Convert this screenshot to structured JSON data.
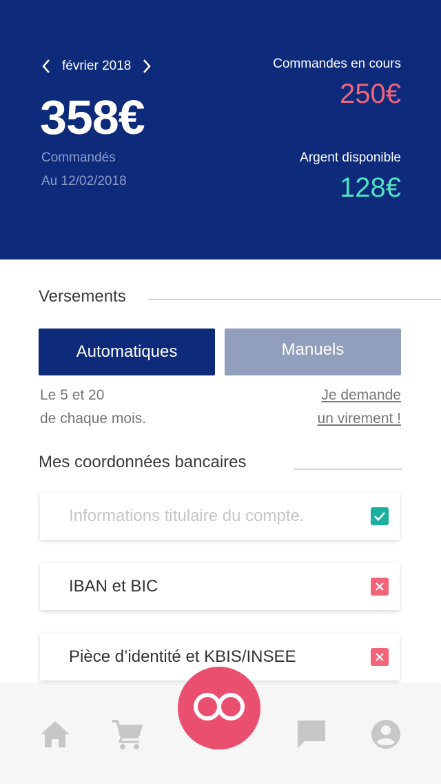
{
  "header": {
    "month": "février 2018",
    "total": "358€",
    "total_label": "Commandés",
    "date_label": "Au 12/02/2018",
    "pending_label": "Commandes en cours",
    "pending_value": "250€",
    "available_label": "Argent disponible",
    "available_value": "128€"
  },
  "payments": {
    "title": "Versements",
    "tabs": [
      "Automatiques",
      "Manuels"
    ],
    "selected_tab": "Automatiques",
    "schedule_line1": "Le 5 et 20",
    "schedule_line2": "de chaque mois.",
    "request_line1": "Je demande",
    "request_line2": "un virement !"
  },
  "bank": {
    "title": "Mes coordonnées bancaires",
    "items": [
      {
        "label": "Informations titulaire du compte.",
        "status": "ok",
        "status_icon": "check-icon"
      },
      {
        "label": "IBAN et BIC",
        "status": "missing",
        "status_icon": "cross-icon"
      },
      {
        "label": "Pièce d’identité et KBIS/INSEE",
        "status": "missing",
        "status_icon": "cross-icon"
      }
    ]
  },
  "tabbar": {
    "items": [
      "home-icon",
      "cart-icon",
      "center-logo-icon",
      "chat-icon",
      "account-icon"
    ]
  },
  "colors": {
    "header_bg": "#0e2a7b",
    "pending": "#f26478",
    "available": "#50e3c2",
    "manual_tab": "#929fbc",
    "ok": "#1ab09f",
    "ko": "#f26478",
    "fab": "#ea4f6f"
  }
}
